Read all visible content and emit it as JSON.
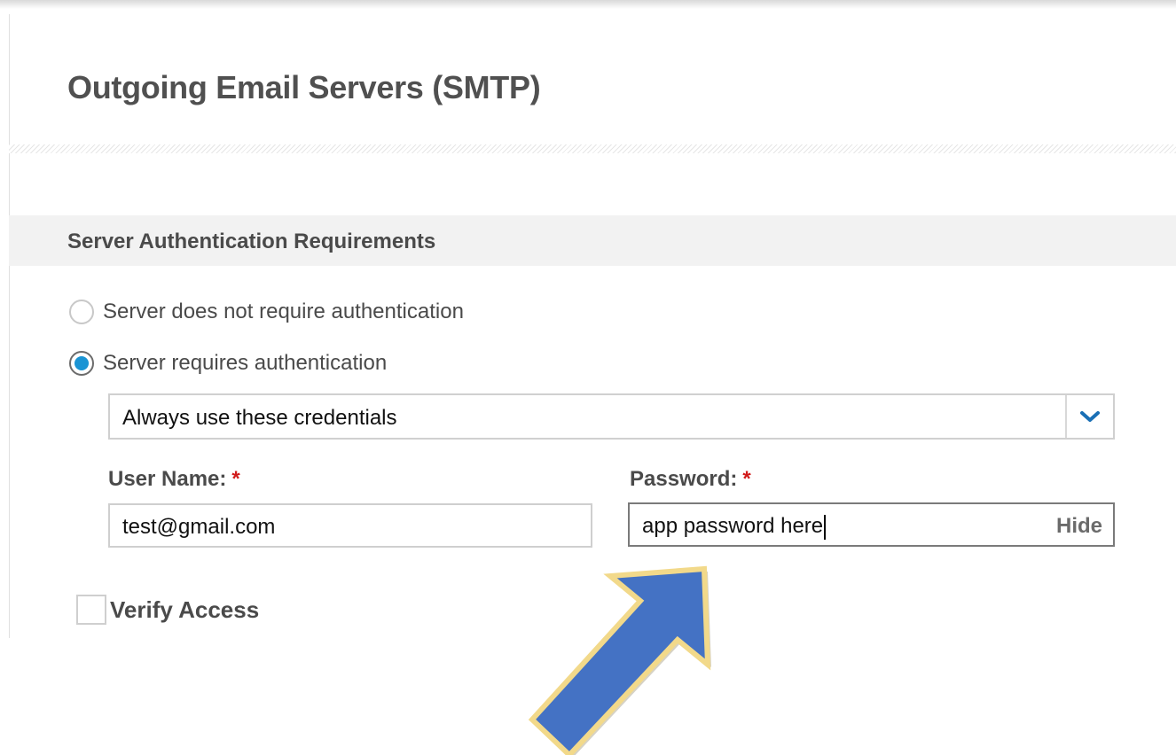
{
  "page": {
    "title": "Outgoing Email Servers (SMTP)"
  },
  "section": {
    "title": "Server Authentication Requirements"
  },
  "auth_options": [
    {
      "label": "Server does not require authentication",
      "selected": false
    },
    {
      "label": "Server requires authentication",
      "selected": true
    }
  ],
  "credentials_select": {
    "value": "Always use these credentials"
  },
  "user_name": {
    "label": "User Name:",
    "required_mark": "*",
    "value": "test@gmail.com"
  },
  "password": {
    "label": "Password:",
    "required_mark": "*",
    "value": "app password here",
    "toggle_label": "Hide"
  },
  "verify_access": {
    "label": "Verify Access",
    "checked": false
  },
  "colors": {
    "radio_selected": "#1a94d4",
    "required": "#d11a1a",
    "arrow_fill": "#4472c4",
    "arrow_outline": "#f2d98a"
  },
  "icons": {
    "select_arrow": "chevron-down-icon",
    "annotation": "pointer-arrow-icon"
  }
}
